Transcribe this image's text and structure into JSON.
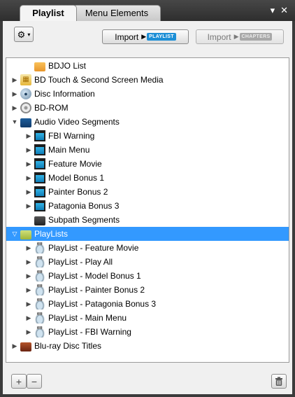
{
  "tabs": {
    "playlist": "Playlist",
    "menu_elements": "Menu Elements"
  },
  "window_controls": {
    "dropdown": "▾",
    "close": "✕"
  },
  "toolbar": {
    "gear_caret": "▾",
    "import_label_1": "Import",
    "import_badge_1": "PLAYLIST",
    "import_label_2": "Import",
    "import_badge_2": "CHAPTERS"
  },
  "tree": {
    "items": [
      {
        "label": "BDJO List",
        "expander": "",
        "icon": "folder-orange-icon"
      },
      {
        "label": "BD Touch & Second Screen Media",
        "expander": "▶",
        "icon": "touch-media-icon"
      },
      {
        "label": "Disc Information",
        "expander": "▶",
        "icon": "disc-info-icon"
      },
      {
        "label": "BD-ROM",
        "expander": "▶",
        "icon": "bd-rom-disc-icon"
      },
      {
        "label": "Audio Video Segments",
        "expander": "▼",
        "icon": "folder-blue-icon"
      },
      {
        "label": "FBI Warning",
        "expander": "▶",
        "icon": "av-segment-icon"
      },
      {
        "label": "Main Menu",
        "expander": "▶",
        "icon": "av-segment-icon"
      },
      {
        "label": "Feature Movie",
        "expander": "▶",
        "icon": "av-segment-icon"
      },
      {
        "label": "Model Bonus 1",
        "expander": "▶",
        "icon": "av-segment-icon"
      },
      {
        "label": "Painter Bonus 2",
        "expander": "▶",
        "icon": "av-segment-icon"
      },
      {
        "label": "Patagonia Bonus 3",
        "expander": "▶",
        "icon": "av-segment-icon"
      },
      {
        "label": "Subpath Segments",
        "expander": "",
        "icon": "folder-dark-icon"
      },
      {
        "label": "PlayLists",
        "expander": "▽",
        "icon": "folder-green-icon"
      },
      {
        "label": "PlayList - Feature Movie",
        "expander": "▶",
        "icon": "playlist-icon"
      },
      {
        "label": "PlayList - Play All",
        "expander": "▶",
        "icon": "playlist-icon"
      },
      {
        "label": "PlayList - Model Bonus 1",
        "expander": "▶",
        "icon": "playlist-icon"
      },
      {
        "label": "PlayList - Painter Bonus 2",
        "expander": "▶",
        "icon": "playlist-icon"
      },
      {
        "label": "PlayList - Patagonia Bonus 3",
        "expander": "▶",
        "icon": "playlist-icon"
      },
      {
        "label": "PlayList - Main Menu",
        "expander": "▶",
        "icon": "playlist-icon"
      },
      {
        "label": "PlayList - FBI Warning",
        "expander": "▶",
        "icon": "playlist-icon"
      },
      {
        "label": "Blu-ray Disc Titles",
        "expander": "▶",
        "icon": "folder-brown-icon"
      }
    ],
    "selected_item": "PlayLists"
  },
  "footer": {
    "add_symbol": "+",
    "remove_symbol": "−"
  },
  "colors": {
    "selection": "#3399ff",
    "panel_dark": "#3b3b3b",
    "badge_playlist": "#1d8fd6"
  }
}
